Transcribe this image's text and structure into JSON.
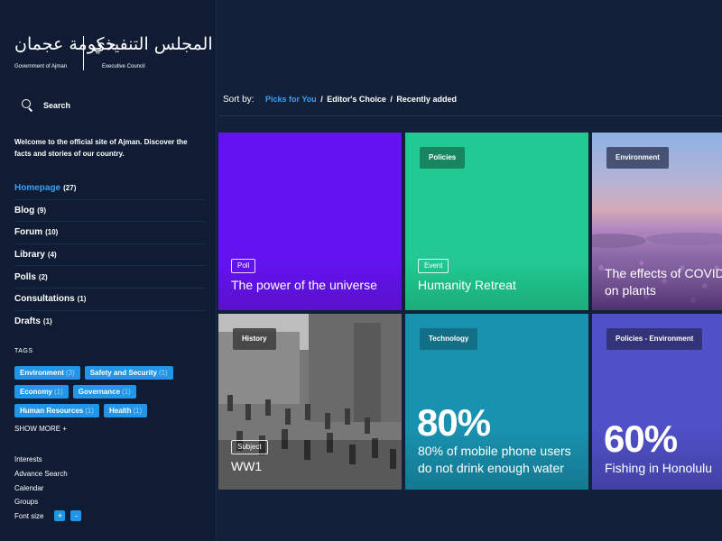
{
  "logo": {
    "gov_arabic": "حكومة عجمان",
    "gov_english": "Government of Ajman",
    "council_arabic": "المجلس التنفيذي",
    "council_english": "Executive Council"
  },
  "search": {
    "label": "Search",
    "icon": "search-icon"
  },
  "welcome_text": "Welcome to the official site of Ajman. Discover the facts and stories of our country.",
  "nav": {
    "items": [
      {
        "label": "Homepage",
        "count": "(27)"
      },
      {
        "label": "Blog",
        "count": "(9)"
      },
      {
        "label": "Forum",
        "count": "(10)"
      },
      {
        "label": "Library",
        "count": "(4)"
      },
      {
        "label": "Polls",
        "count": "(2)"
      },
      {
        "label": "Consultations",
        "count": "(1)"
      },
      {
        "label": "Drafts",
        "count": "(1)"
      }
    ],
    "active": "Homepage"
  },
  "tags": {
    "title": "TAGS",
    "items": [
      {
        "label": "Environment",
        "count": "(3)"
      },
      {
        "label": "Safety and Security",
        "count": "(1)"
      },
      {
        "label": "Economy",
        "count": "(1)"
      },
      {
        "label": "Governance",
        "count": "(1)"
      },
      {
        "label": "Human Resources",
        "count": "(1)"
      },
      {
        "label": "Health",
        "count": "(1)"
      }
    ],
    "show_more": "SHOW MORE +"
  },
  "utility": {
    "items": [
      "Interests",
      "Advance Search",
      "Calendar",
      "Groups"
    ],
    "font_size_label": "Font size",
    "increase": "+",
    "decrease": "-"
  },
  "sort": {
    "label": "Sort by:",
    "options": [
      "Picks for You",
      "Editor's Choice",
      "Recently added"
    ],
    "separator": "/",
    "active": "Picks for You"
  },
  "cards": [
    {
      "category": "Poll",
      "title": "The power of the universe",
      "color": "#6213f0"
    },
    {
      "badge": "Policies",
      "category": "Event",
      "title": "Humanity Retreat",
      "color": "#22c993"
    },
    {
      "badge": "Environment",
      "title_line1": "The effects of COVID",
      "title_line2": "on plants"
    },
    {
      "badge": "History",
      "category": "Subject",
      "title": "WW1"
    },
    {
      "badge": "Technology",
      "stat": "80%",
      "line1": "80% of mobile phone users",
      "line2": "do not drink enough water",
      "color": "#1992b0"
    },
    {
      "badge": "Policies - Environment",
      "stat": "60%",
      "line1": "Fishing in Honolulu",
      "color": "#5050c8"
    }
  ],
  "colors": {
    "accent": "#3aa0f3",
    "sidebar_bg": "#0f1c33",
    "page_bg": "#13203a",
    "tag_bg": "#2196e8"
  }
}
